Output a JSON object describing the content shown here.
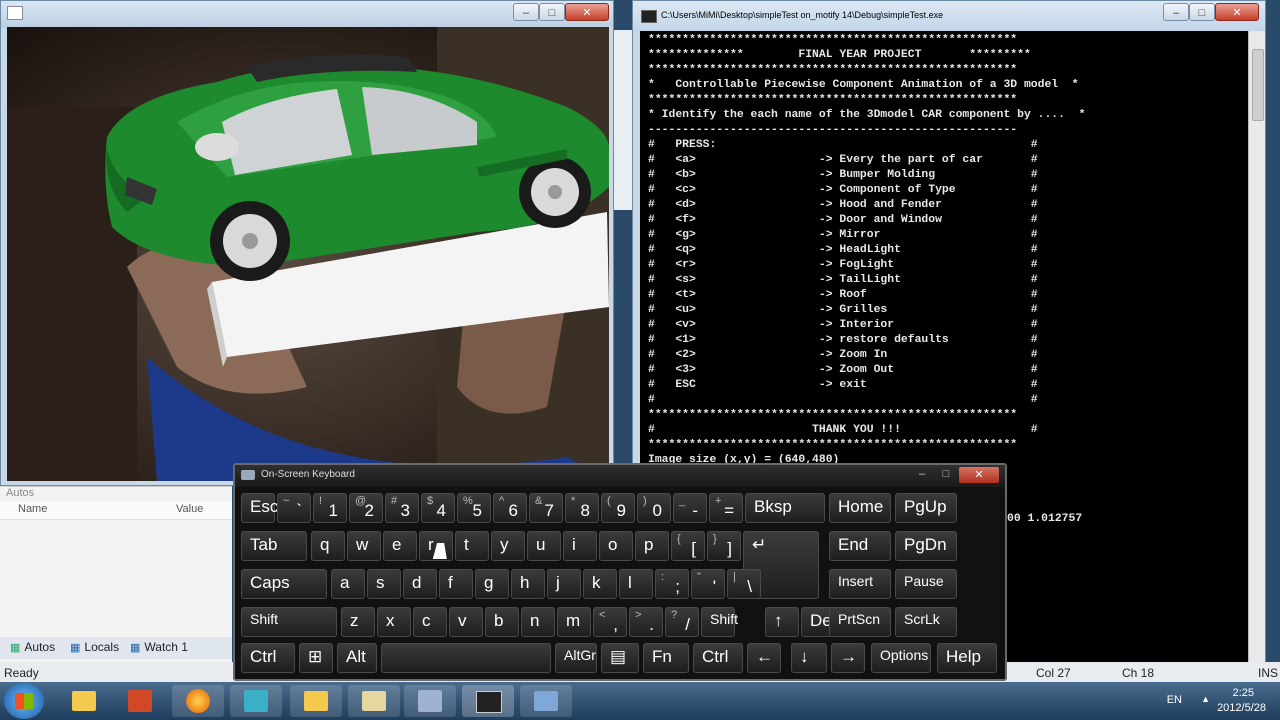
{
  "console": {
    "title": "C:\\Users\\MiMi\\Desktop\\simpleTest on_motify 14\\Debug\\simpleTest.exe",
    "lines": [
      "******************************************************",
      "**************        FINAL YEAR PROJECT       *********",
      "******************************************************",
      "*   Controllable Piecewise Component Animation of a 3D model  *",
      "******************************************************",
      "* Identify the each name of the 3Dmodel CAR component by ....  *",
      "------------------------------------------------------",
      "#   PRESS:                                              #",
      "#   <a>                  -> Every the part of car       #",
      "#   <b>                  -> Bumper Molding              #",
      "#   <c>                  -> Component of Type           #",
      "#   <d>                  -> Hood and Fender             #",
      "#   <f>                  -> Door and Window             #",
      "#   <g>                  -> Mirror                      #",
      "#   <q>                  -> HeadLight                   #",
      "#   <r>                  -> FogLight                    #",
      "#   <s>                  -> TailLight                   #",
      "#   <t>                  -> Roof                        #",
      "#   <u>                  -> Grilles                     #",
      "#   <v>                  -> Interior                    #",
      "#   <1>                  -> restore defaults            #",
      "#   <2>                  -> Zoom In                     #",
      "#   <3>                  -> Zoom Out                    #",
      "#   ESC                  -> exit                        #",
      "#                                                       #",
      "******************************************************",
      "#                       THANK YOU !!!                   #",
      "******************************************************",
      "Image size (x,y) = (640,480)"
    ],
    "tail_value": "00 1.012757"
  },
  "ide": {
    "autos_header": "Autos",
    "col_name": "Name",
    "col_value": "Value",
    "tab_autos": "Autos",
    "tab_locals": "Locals",
    "tab_watch": "Watch 1",
    "status": "Ready",
    "col": "Col 27",
    "ch": "Ch 18",
    "ins": "INS"
  },
  "osk": {
    "title": "On-Screen Keyboard",
    "rows": [
      [
        [
          "Esc",
          ""
        ],
        [
          "~",
          "`"
        ],
        [
          "!",
          "1"
        ],
        [
          "@",
          "2"
        ],
        [
          "#",
          "3"
        ],
        [
          "$",
          "4"
        ],
        [
          "%",
          "5"
        ],
        [
          "^",
          "6"
        ],
        [
          "&",
          "7"
        ],
        [
          "*",
          "8"
        ],
        [
          "(",
          "9"
        ],
        [
          ")",
          "0"
        ],
        [
          "_",
          "-"
        ],
        [
          "+",
          "="
        ],
        [
          "Bksp",
          ""
        ],
        [
          "Home",
          ""
        ],
        [
          "PgUp",
          ""
        ]
      ],
      [
        [
          "Tab",
          ""
        ],
        [
          "q",
          ""
        ],
        [
          "w",
          ""
        ],
        [
          "e",
          ""
        ],
        [
          "r",
          ""
        ],
        [
          "t",
          ""
        ],
        [
          "y",
          ""
        ],
        [
          "u",
          ""
        ],
        [
          "i",
          ""
        ],
        [
          "o",
          ""
        ],
        [
          "p",
          ""
        ],
        [
          "{",
          "["
        ],
        [
          "}",
          "]"
        ],
        [
          "↵",
          ""
        ],
        [
          "End",
          ""
        ],
        [
          "PgDn",
          ""
        ]
      ],
      [
        [
          "Caps",
          ""
        ],
        [
          "a",
          ""
        ],
        [
          "s",
          ""
        ],
        [
          "d",
          ""
        ],
        [
          "f",
          ""
        ],
        [
          "g",
          ""
        ],
        [
          "h",
          ""
        ],
        [
          "j",
          ""
        ],
        [
          "k",
          ""
        ],
        [
          "l",
          ""
        ],
        [
          ":",
          ";"
        ],
        [
          "\"",
          "'"
        ],
        [
          "|",
          "\\"
        ],
        [
          "Insert",
          ""
        ],
        [
          "Pause",
          ""
        ]
      ],
      [
        [
          "Shift",
          ""
        ],
        [
          "z",
          ""
        ],
        [
          "x",
          ""
        ],
        [
          "c",
          ""
        ],
        [
          "v",
          ""
        ],
        [
          "b",
          ""
        ],
        [
          "n",
          ""
        ],
        [
          "m",
          ""
        ],
        [
          "<",
          ","
        ],
        [
          ">",
          "."
        ],
        [
          "?",
          "/"
        ],
        [
          "Shift",
          ""
        ],
        [
          "↑",
          ""
        ],
        [
          "Del",
          ""
        ],
        [
          "PrtScn",
          ""
        ],
        [
          "ScrLk",
          ""
        ]
      ],
      [
        [
          "Ctrl",
          ""
        ],
        [
          "⊞",
          ""
        ],
        [
          "Alt",
          ""
        ],
        [
          "",
          ""
        ],
        [
          "AltGr",
          ""
        ],
        [
          "▤",
          ""
        ],
        [
          "Fn",
          ""
        ],
        [
          "Ctrl",
          ""
        ],
        [
          "←",
          ""
        ],
        [
          "↓",
          ""
        ],
        [
          "→",
          ""
        ],
        [
          "Options",
          ""
        ],
        [
          "Help",
          ""
        ]
      ]
    ]
  },
  "tray": {
    "lang": "EN",
    "time": "2:25",
    "date": "2012/5/28"
  },
  "taskbar_apps": [
    "start",
    "explorer",
    "powerpoint",
    "firefox",
    "media",
    "folder",
    "app1",
    "app2",
    "console",
    "network"
  ]
}
